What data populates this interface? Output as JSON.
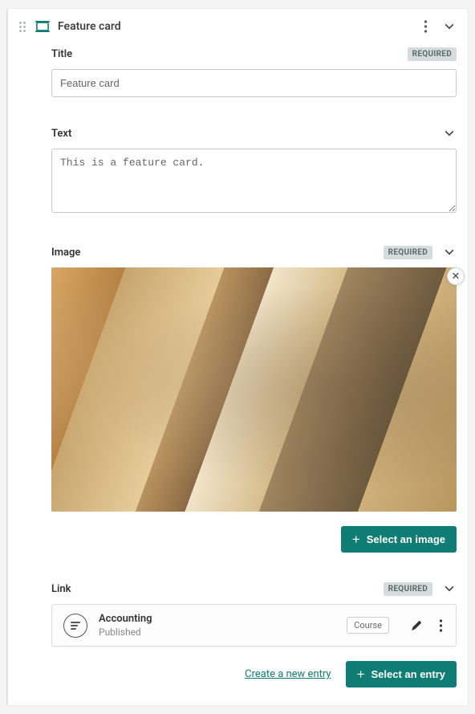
{
  "header": {
    "title": "Feature card",
    "required_label": "REQUIRED"
  },
  "fields": {
    "title": {
      "label": "Title",
      "value": "Feature card"
    },
    "text": {
      "label": "Text",
      "value": "This is a feature card."
    },
    "image": {
      "label": "Image",
      "select_button": "Select an image"
    },
    "link": {
      "label": "Link",
      "entry": {
        "title": "Accounting",
        "status": "Published",
        "type_tag": "Course"
      },
      "create_link": "Create a new entry",
      "select_button": "Select an entry"
    }
  }
}
